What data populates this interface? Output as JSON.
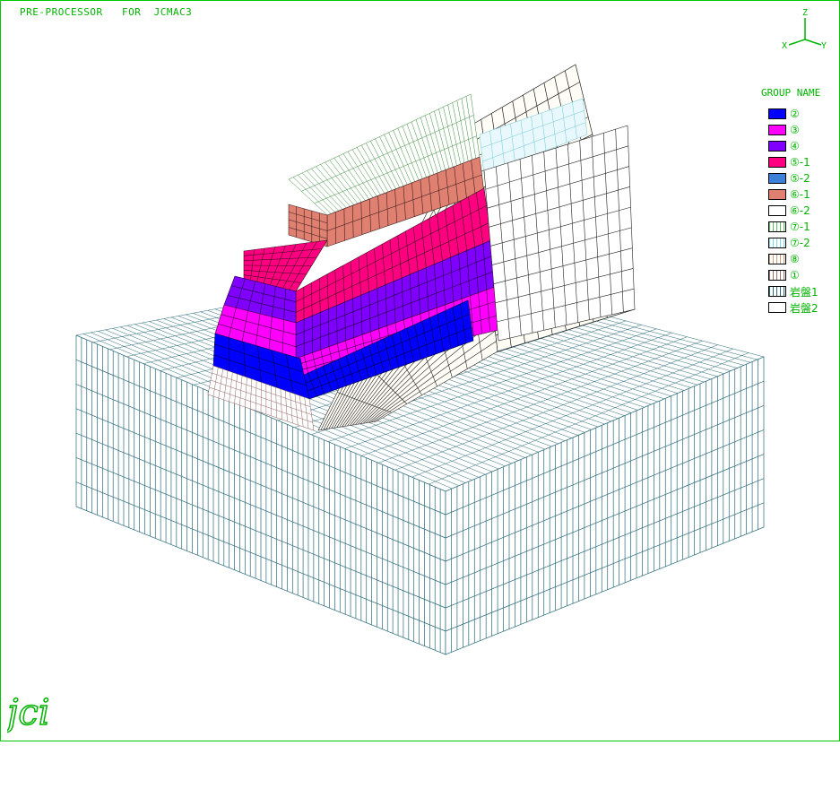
{
  "app": {
    "title": "PRE-PROCESSOR   FOR  JCMAC3"
  },
  "axes": {
    "z": "Z",
    "x": "X",
    "y": "Y"
  },
  "legend": {
    "title": "GROUP NAME",
    "items": [
      {
        "label": "②",
        "color": "#0000ff",
        "hatch": false
      },
      {
        "label": "③",
        "color": "#ff00ff",
        "hatch": false
      },
      {
        "label": "④",
        "color": "#8000ff",
        "hatch": false
      },
      {
        "label": "⑤-1",
        "color": "#ff0080",
        "hatch": false
      },
      {
        "label": "⑤-2",
        "color": "#3c80d8",
        "hatch": false
      },
      {
        "label": "⑥-1",
        "color": "#e08070",
        "hatch": false
      },
      {
        "label": "⑥-2",
        "color": "#ffffff",
        "hatch": false
      },
      {
        "label": "⑦-1",
        "color": "#ffffff",
        "hatch": true,
        "hatchColor": "#60c060"
      },
      {
        "label": "⑦-2",
        "color": "#ffffff",
        "hatch": true,
        "hatchColor": "#80d8e8"
      },
      {
        "label": "⑧",
        "color": "#ffffff",
        "hatch": true,
        "hatchColor": "#c8a080"
      },
      {
        "label": "①",
        "color": "#ffffff",
        "hatch": true,
        "hatchColor": "#a07070"
      },
      {
        "label": "岩盤1",
        "color": "#ffffff",
        "hatch": true,
        "hatchColor": "#2a6a7a"
      },
      {
        "label": "岩盤2",
        "color": "#ffffff",
        "hatch": false
      }
    ]
  },
  "logo": {
    "text": "jci",
    "color": "#00b400"
  }
}
